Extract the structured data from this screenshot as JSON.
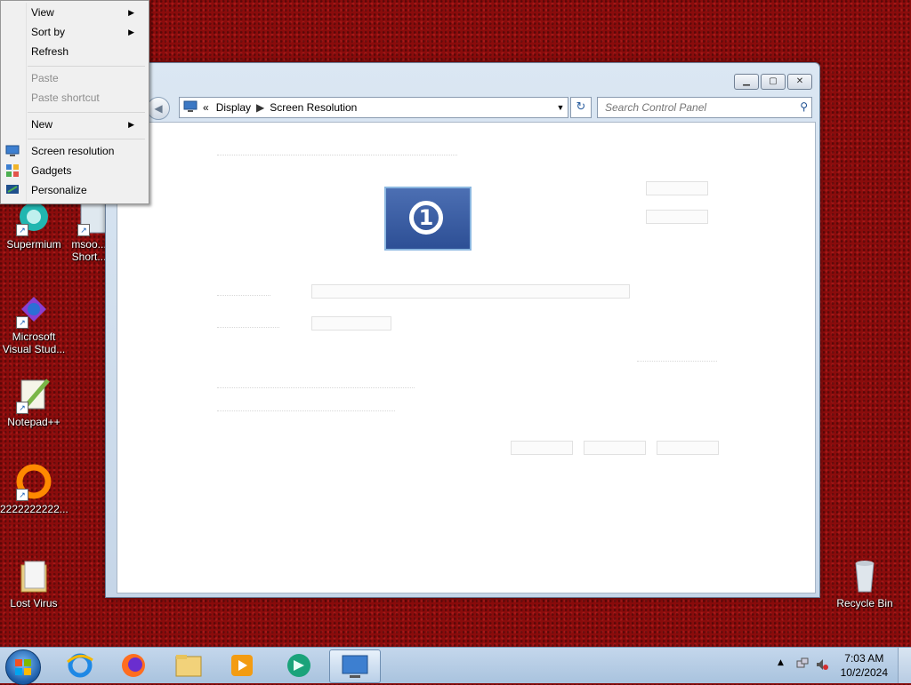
{
  "context_menu": {
    "view": "View",
    "sort_by": "Sort by",
    "refresh": "Refresh",
    "paste": "Paste",
    "paste_shortcut": "Paste shortcut",
    "new": "New",
    "screen_resolution": "Screen resolution",
    "gadgets": "Gadgets",
    "personalize": "Personalize"
  },
  "window": {
    "breadcrumb_root": "«",
    "breadcrumb_1": "Display",
    "breadcrumb_2": "Screen Resolution",
    "search_placeholder": "Search Control Panel",
    "monitor_number": "1"
  },
  "desktop": {
    "icons": [
      {
        "label": "Supermium"
      },
      {
        "label": "msoo... Short..."
      },
      {
        "label": "Microsoft Visual Stud..."
      },
      {
        "label": "Notepad++"
      },
      {
        "label": "2222222222..."
      },
      {
        "label": "Lost Virus"
      },
      {
        "label": "Recycle Bin"
      }
    ]
  },
  "taskbar": {
    "time": "7:03 AM",
    "date": "10/2/2024"
  },
  "colors": {
    "desktop_bg": "#8a0c0c",
    "taskbar": "#b7cde6",
    "accent": "#1e4f91"
  }
}
